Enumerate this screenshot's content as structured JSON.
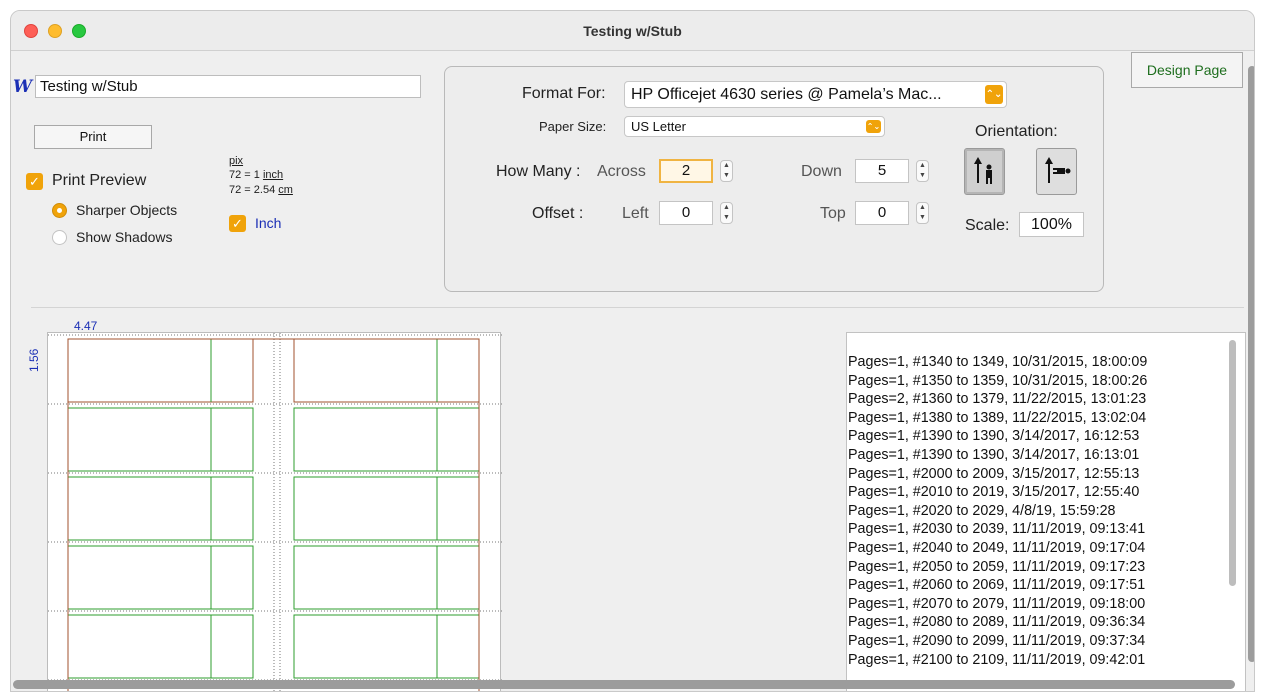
{
  "window": {
    "title": "Testing w/Stub"
  },
  "document": {
    "icon": "W",
    "name": "Testing w/Stub"
  },
  "left_panel": {
    "print_label": "Print",
    "print_preview_label": "Print Preview",
    "print_preview_checked": true,
    "render_options": [
      {
        "label": "Sharper Objects",
        "selected": true
      },
      {
        "label": "Show Shadows",
        "selected": false
      }
    ],
    "units": {
      "pix": "pix",
      "inch_prefix": "72 = 1 ",
      "inch_unit": "inch",
      "cm_prefix": "72 = 2.54 ",
      "cm_unit": "cm",
      "inch_label": "Inch",
      "inch_checked": true
    }
  },
  "settings": {
    "format_for_label": "Format For:",
    "format_for_value": "HP Officejet 4630 series @ Pamela’s Mac...",
    "paper_size_label": "Paper Size:",
    "paper_size_value": "US Letter",
    "how_many_label": "How Many :",
    "across_label": "Across",
    "across_value": "2",
    "down_label": "Down",
    "down_value": "5",
    "offset_label": "Offset :",
    "left_label": "Left",
    "left_value": "0",
    "top_label": "Top",
    "top_value": "0",
    "orientation_label": "Orientation:",
    "orientation_selected": "portrait",
    "scale_label": "Scale:",
    "scale_value": "100%"
  },
  "design_page_label": "Design Page",
  "preview": {
    "ruler_width": "4.47",
    "ruler_height": "1.56",
    "grid_rows": 5,
    "grid_cols": 2
  },
  "log": [
    "Pages=1, #1340 to 1349, 10/31/2015, 18:00:09",
    "Pages=1, #1350 to 1359, 10/31/2015, 18:00:26",
    "Pages=2, #1360 to 1379, 11/22/2015, 13:01:23",
    "Pages=1, #1380 to 1389, 11/22/2015, 13:02:04",
    "Pages=1, #1390 to 1390, 3/14/2017, 16:12:53",
    "Pages=1, #1390 to 1390, 3/14/2017, 16:13:01",
    "Pages=1, #2000 to 2009, 3/15/2017, 12:55:13",
    "Pages=1, #2010 to 2019, 3/15/2017, 12:55:40",
    "Pages=1, #2020 to 2029, 4/8/19, 15:59:28",
    "Pages=1, #2030 to 2039, 11/11/2019, 09:13:41",
    "Pages=1, #2040 to 2049, 11/11/2019, 09:17:04",
    "Pages=1, #2050 to 2059, 11/11/2019, 09:17:23",
    "Pages=1, #2060 to 2069, 11/11/2019, 09:17:51",
    "Pages=1, #2070 to 2079, 11/11/2019, 09:18:00",
    "Pages=1, #2080 to 2089, 11/11/2019, 09:36:34",
    "Pages=1, #2090 to 2099, 11/11/2019, 09:37:34",
    "Pages=1, #2100 to 2109, 11/11/2019, 09:42:01"
  ],
  "colors": {
    "accent": "#f0a30a",
    "label_border": "#a0522d",
    "stub_divider": "#2e9e2e",
    "blue_text": "#1b2fb5"
  }
}
